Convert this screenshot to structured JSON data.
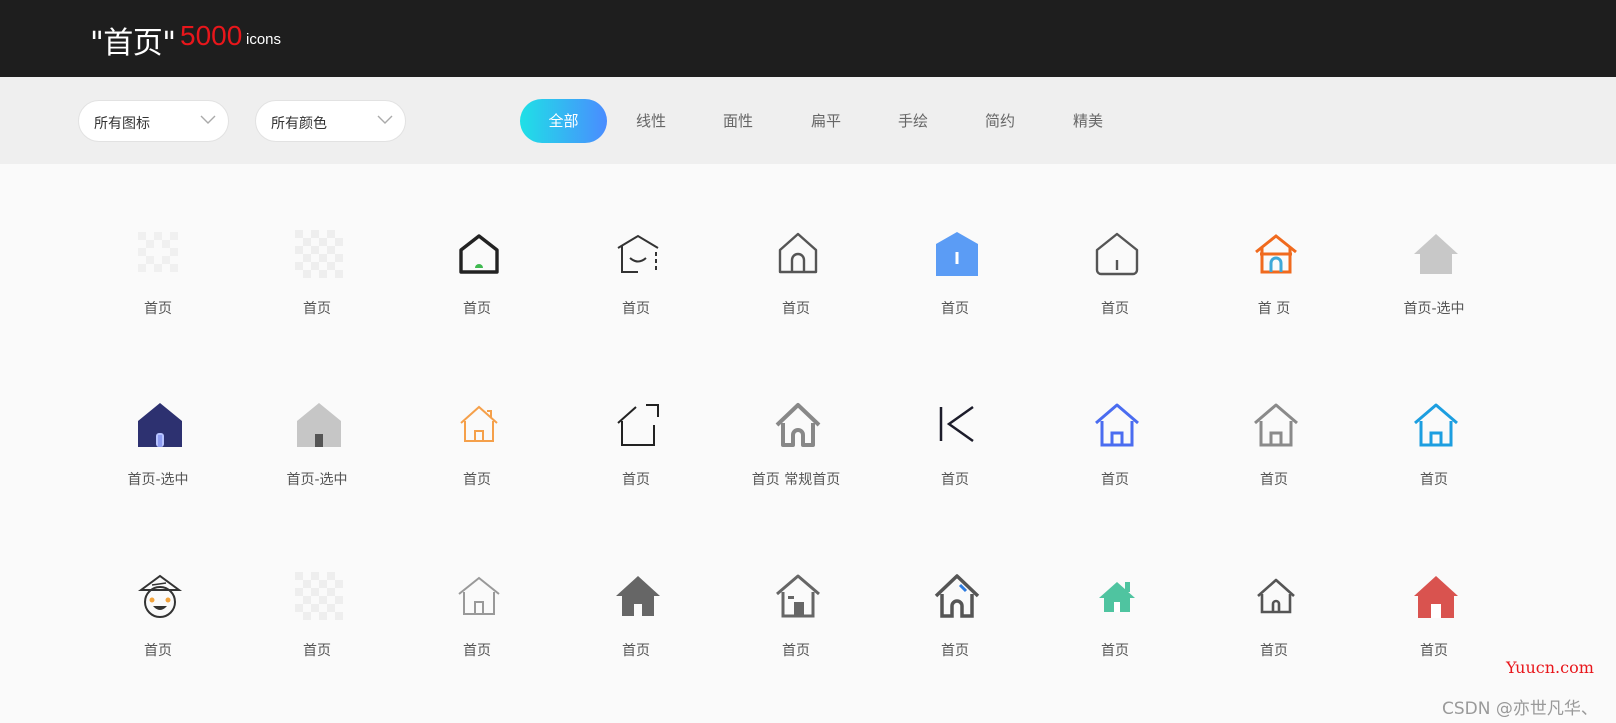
{
  "header": {
    "title": "\"首页\"",
    "count": "5000",
    "unit": "icons"
  },
  "filters": {
    "icon_select": "所有图标",
    "color_select": "所有颜色",
    "tabs": [
      "全部",
      "线性",
      "面性",
      "扁平",
      "手绘",
      "简约",
      "精美"
    ],
    "active_tab": "全部"
  },
  "icons": [
    {
      "name": "首页",
      "icon": "placeholder-grid-icon"
    },
    {
      "name": "首页",
      "icon": "placeholder-checker-icon"
    },
    {
      "name": "首页",
      "icon": "home-outline-green-door-icon"
    },
    {
      "name": "首页",
      "icon": "home-smile-outline-icon"
    },
    {
      "name": "首页",
      "icon": "home-arch-outline-icon"
    },
    {
      "name": "首页",
      "icon": "home-blue-pentagon-icon"
    },
    {
      "name": "首页",
      "icon": "home-outline-gray-icon"
    },
    {
      "name": "首 页",
      "icon": "home-orange-blue-icon"
    },
    {
      "name": "首页-选中",
      "icon": "home-solid-lightgray-icon"
    },
    {
      "name": "首页-选中",
      "icon": "home-solid-navy-icon"
    },
    {
      "name": "首页-选中",
      "icon": "home-solid-gray-icon"
    },
    {
      "name": "首页",
      "icon": "home-outline-orange-icon"
    },
    {
      "name": "首页",
      "icon": "home-open-corner-icon"
    },
    {
      "name": "首页 常规首页",
      "icon": "home-arch-gray-icon"
    },
    {
      "name": "首页",
      "icon": "home-k-glyph-icon"
    },
    {
      "name": "首页",
      "icon": "home-outline-blue-icon"
    },
    {
      "name": "首页",
      "icon": "home-outline-gray2-icon"
    },
    {
      "name": "首页",
      "icon": "home-outline-skyblue-icon"
    },
    {
      "name": "首页",
      "icon": "home-face-icon"
    },
    {
      "name": "首页",
      "icon": "placeholder-checker2-icon"
    },
    {
      "name": "首页",
      "icon": "home-thin-outline-icon"
    },
    {
      "name": "首页",
      "icon": "home-solid-darkgray-icon"
    },
    {
      "name": "首页",
      "icon": "home-outline-window-icon"
    },
    {
      "name": "首页",
      "icon": "home-outline-bluestroke-icon"
    },
    {
      "name": "首页",
      "icon": "home-solid-teal-icon"
    },
    {
      "name": "首页",
      "icon": "home-outline-small-icon"
    },
    {
      "name": "首页",
      "icon": "home-solid-red-icon"
    }
  ],
  "watermarks": {
    "site": "Yuucn.com",
    "author": "CSDN @亦世凡华、"
  },
  "colors": {
    "header_bg": "#1e1e1e",
    "count_red": "#e8161b",
    "tab_gradient_start": "#1fe0e6",
    "tab_gradient_end": "#4a8cff"
  }
}
